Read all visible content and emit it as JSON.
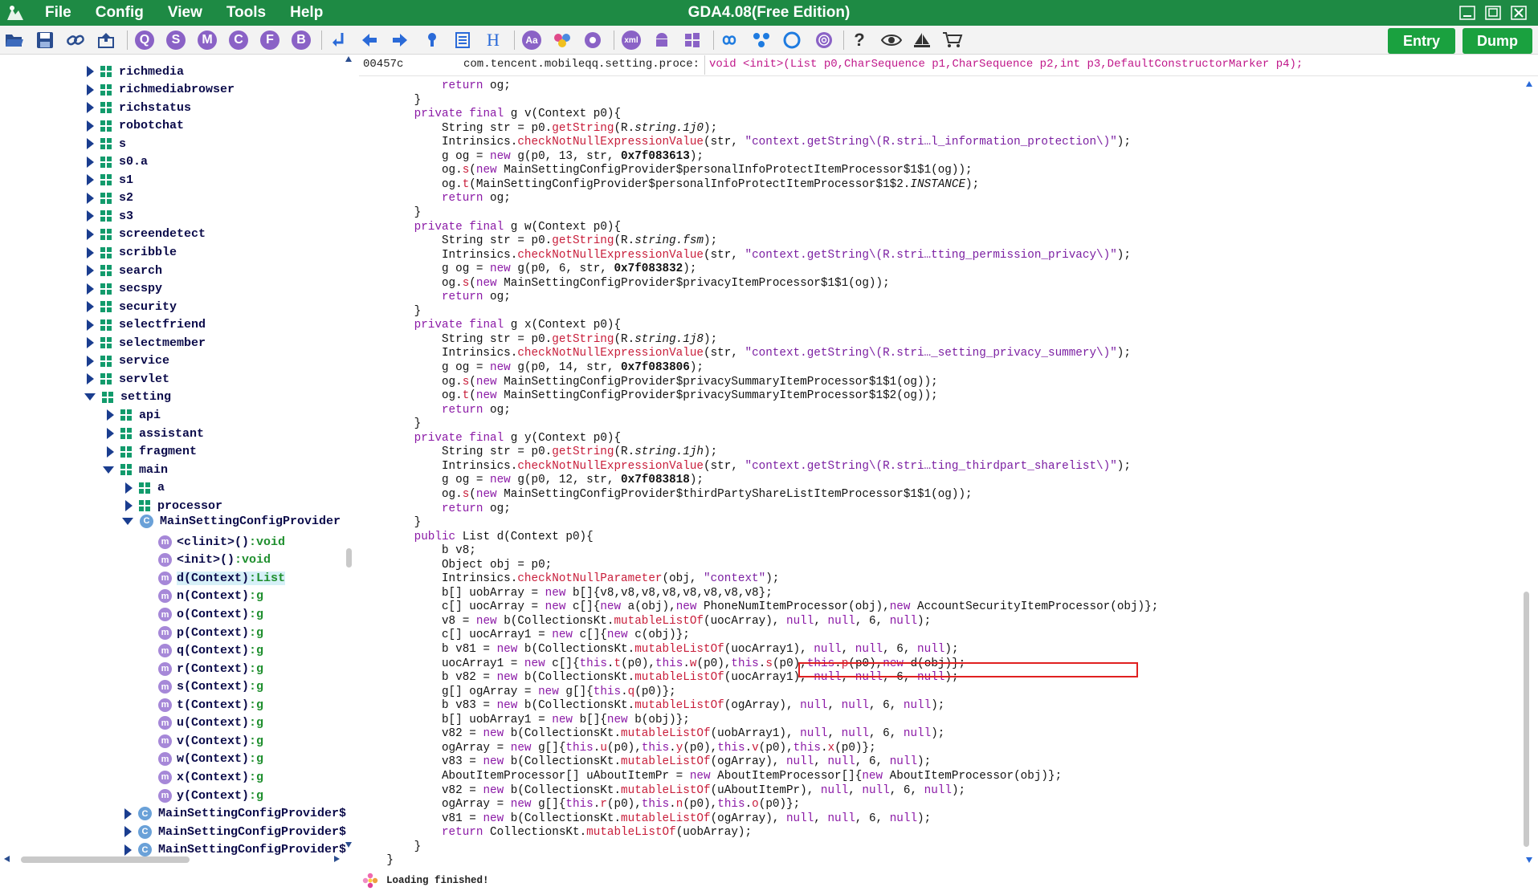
{
  "app": {
    "title": "GDA4.08(Free Edition)",
    "menu": [
      "File",
      "Config",
      "View",
      "Tools",
      "Help"
    ]
  },
  "toolbar": {
    "letter_buttons": [
      "Q",
      "S",
      "M",
      "C",
      "F",
      "B"
    ],
    "entry_label": "Entry",
    "dump_label": "Dump",
    "accent_color": "#1aa13f",
    "titlebar_color": "#1e8a44"
  },
  "tree": {
    "packages": [
      "richmedia",
      "richmediabrowser",
      "richstatus",
      "robotchat",
      "s",
      "s0.a",
      "s1",
      "s2",
      "s3",
      "screendetect",
      "scribble",
      "search",
      "secspy",
      "security",
      "selectfriend",
      "selectmember",
      "service",
      "servlet"
    ],
    "setting_label": "setting",
    "setting_children": [
      "api",
      "assistant",
      "fragment"
    ],
    "main_label": "main",
    "main_children": [
      "a",
      "processor"
    ],
    "class_label": "MainSettingConfigProvider",
    "methods": [
      {
        "name": "<clinit>()",
        "sig": ":void"
      },
      {
        "name": "<init>()",
        "sig": ":void"
      },
      {
        "name": "d(Context)",
        "sig": ":List"
      },
      {
        "name": "n(Context)",
        "sig": ":g"
      },
      {
        "name": "o(Context)",
        "sig": ":g"
      },
      {
        "name": "p(Context)",
        "sig": ":g"
      },
      {
        "name": "q(Context)",
        "sig": ":g"
      },
      {
        "name": "r(Context)",
        "sig": ":g"
      },
      {
        "name": "s(Context)",
        "sig": ":g"
      },
      {
        "name": "t(Context)",
        "sig": ":g"
      },
      {
        "name": "u(Context)",
        "sig": ":g"
      },
      {
        "name": "v(Context)",
        "sig": ":g"
      },
      {
        "name": "w(Context)",
        "sig": ":g"
      },
      {
        "name": "x(Context)",
        "sig": ":g"
      },
      {
        "name": "y(Context)",
        "sig": ":g"
      }
    ],
    "inner_classes": [
      "MainSettingConfigProvider$",
      "MainSettingConfigProvider$",
      "MainSettingConfigProvider$"
    ]
  },
  "editor": {
    "address": "00457c",
    "class_path": "com.tencent.mobileqq.setting.proce:",
    "method_signature": "void <init>(List p0,CharSequence p1,CharSequence p2,int p3,DefaultConstructorMarker p4);"
  },
  "code_lines": [
    "            return og;",
    "        }",
    "        private final g v(Context p0){",
    "            String str = p0.getString(R.string.1j0);",
    "            Intrinsics.checkNotNullExpressionValue(str, \"context.getString\\(R.stri…l_information_protection\\)\");",
    "            g og = new g(p0, 13, str, 0x7f083613);",
    "            og.s(new MainSettingConfigProvider$personalInfoProtectItemProcessor$1$1(og));",
    "            og.t(MainSettingConfigProvider$personalInfoProtectItemProcessor$1$2.INSTANCE);",
    "            return og;",
    "        }",
    "        private final g w(Context p0){",
    "            String str = p0.getString(R.string.fsm);",
    "            Intrinsics.checkNotNullExpressionValue(str, \"context.getString\\(R.stri…tting_permission_privacy\\)\");",
    "            g og = new g(p0, 6, str, 0x7f083832);",
    "            og.s(new MainSettingConfigProvider$privacyItemProcessor$1$1(og));",
    "            return og;",
    "        }",
    "        private final g x(Context p0){",
    "            String str = p0.getString(R.string.1j8);",
    "            Intrinsics.checkNotNullExpressionValue(str, \"context.getString\\(R.stri…_setting_privacy_summery\\)\");",
    "            g og = new g(p0, 14, str, 0x7f083806);",
    "            og.s(new MainSettingConfigProvider$privacySummaryItemProcessor$1$1(og));",
    "            og.t(new MainSettingConfigProvider$privacySummaryItemProcessor$1$2(og));",
    "            return og;",
    "        }",
    "        private final g y(Context p0){",
    "            String str = p0.getString(R.string.1jh);",
    "            Intrinsics.checkNotNullExpressionValue(str, \"context.getString\\(R.stri…ting_thirdpart_sharelist\\)\");",
    "            g og = new g(p0, 12, str, 0x7f083818);",
    "            og.s(new MainSettingConfigProvider$thirdPartyShareListItemProcessor$1$1(og));",
    "            return og;",
    "        }",
    "        public List d(Context p0){",
    "            b v8;",
    "            Object obj = p0;",
    "            Intrinsics.checkNotNullParameter(obj, \"context\");",
    "            b[] uobArray = new b[]{v8,v8,v8,v8,v8,v8,v8,v8};",
    "            c[] uocArray = new c[]{new a(obj),new PhoneNumItemProcessor(obj),new AccountSecurityItemProcessor(obj)};",
    "            v8 = new b(CollectionsKt.mutableListOf(uocArray), null, null, 6, null);",
    "            c[] uocArray1 = new c[]{new c(obj)};",
    "            b v81 = new b(CollectionsKt.mutableListOf(uocArray1), null, null, 6, null);",
    "            uocArray1 = new c[]{this.t(p0),this.w(p0),this.s(p0),this.p(p0),new d(obj)};",
    "            b v82 = new b(CollectionsKt.mutableListOf(uocArray1), null, null, 6, null);",
    "            g[] ogArray = new g[]{this.q(p0)};",
    "            b v83 = new b(CollectionsKt.mutableListOf(ogArray), null, null, 6, null);",
    "            b[] uobArray1 = new b[]{new b(obj)};",
    "            v82 = new b(CollectionsKt.mutableListOf(uobArray1), null, null, 6, null);",
    "            ogArray = new g[]{this.u(p0),this.y(p0),this.v(p0),this.x(p0)};",
    "            v83 = new b(CollectionsKt.mutableListOf(ogArray), null, null, 6, null);",
    "            AboutItemProcessor[] uAboutItemPr = new AboutItemProcessor[]{new AboutItemProcessor(obj)};",
    "            v82 = new b(CollectionsKt.mutableListOf(uAboutItemPr), null, null, 6, null);",
    "            ogArray = new g[]{this.r(p0),this.n(p0),this.o(p0)};",
    "            v81 = new b(CollectionsKt.mutableListOf(ogArray), null, null, 6, null);",
    "            return CollectionsKt.mutableListOf(uobArray);",
    "        }",
    "    }"
  ],
  "status": {
    "text": "Loading finished!"
  }
}
